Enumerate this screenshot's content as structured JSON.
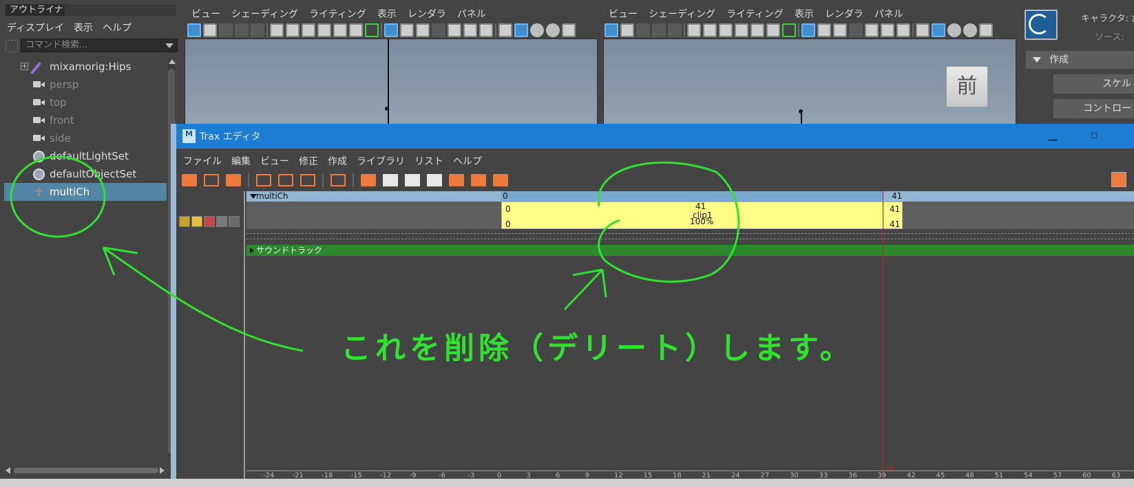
{
  "outliner": {
    "title": "アウトライナ",
    "menu": [
      "ディスプレイ",
      "表示",
      "ヘルプ"
    ],
    "search_placeholder": "コマンド検索...",
    "items": [
      {
        "label": "mixamorig:Hips",
        "icon": "bone-icon",
        "state": "normal"
      },
      {
        "label": "persp",
        "icon": "camera-icon",
        "state": "dim"
      },
      {
        "label": "top",
        "icon": "camera-icon",
        "state": "dim"
      },
      {
        "label": "front",
        "icon": "camera-icon",
        "state": "dim"
      },
      {
        "label": "side",
        "icon": "camera-icon",
        "state": "dim"
      },
      {
        "label": "defaultLightSet",
        "icon": "set-icon",
        "state": "normal"
      },
      {
        "label": "defaultObjectSet",
        "icon": "set-icon",
        "state": "normal"
      },
      {
        "label": "multiCh",
        "icon": "character-icon",
        "state": "selected"
      }
    ]
  },
  "viewport_left": {
    "menu": [
      "ビュー",
      "シェーディング",
      "ライティング",
      "表示",
      "レンダラ",
      "パネル"
    ]
  },
  "viewport_right": {
    "menu": [
      "ビュー",
      "シェーディング",
      "ライティング",
      "表示",
      "レンダラ",
      "パネル"
    ],
    "view_cube_label": "前"
  },
  "right_panel": {
    "character_label": "キャラクタ: た",
    "source_label": "ソース:",
    "section": "作成",
    "buttons": [
      "スケル",
      "コントロー"
    ]
  },
  "trax": {
    "title": "Trax エディタ",
    "logo": "M",
    "menu": [
      "ファイル",
      "編集",
      "ビュー",
      "修正",
      "作成",
      "ライブラリ",
      "リスト",
      "ヘルプ"
    ],
    "track_name": "multiCh",
    "header_start": "0",
    "header_end": "41",
    "clip": {
      "start_top": "0",
      "start_mid": "0",
      "frames": "41",
      "name": "clip1",
      "weight": "100%",
      "end_top": "41",
      "end_bottom": "41"
    },
    "soundtrack": "サウンドトラック",
    "playhead_frame": "39",
    "timeline_labels": [
      "-24",
      "-21",
      "-18",
      "-15",
      "-12",
      "-9",
      "-6",
      "-3",
      "0",
      "3",
      "6",
      "9",
      "12",
      "15",
      "18",
      "21",
      "24",
      "27",
      "30",
      "33",
      "36",
      "39",
      "42",
      "45",
      "48",
      "51",
      "54",
      "57",
      "60",
      "63"
    ]
  },
  "annotation": {
    "text": "これを削除（デリート）します。",
    "color": "#2ee22e"
  },
  "colors": {
    "selection": "#5285a6",
    "title_bar": "#1c7dd3",
    "clip": "#ffff88",
    "soundtrack": "#2c8a2c",
    "playhead": "#d02020"
  }
}
